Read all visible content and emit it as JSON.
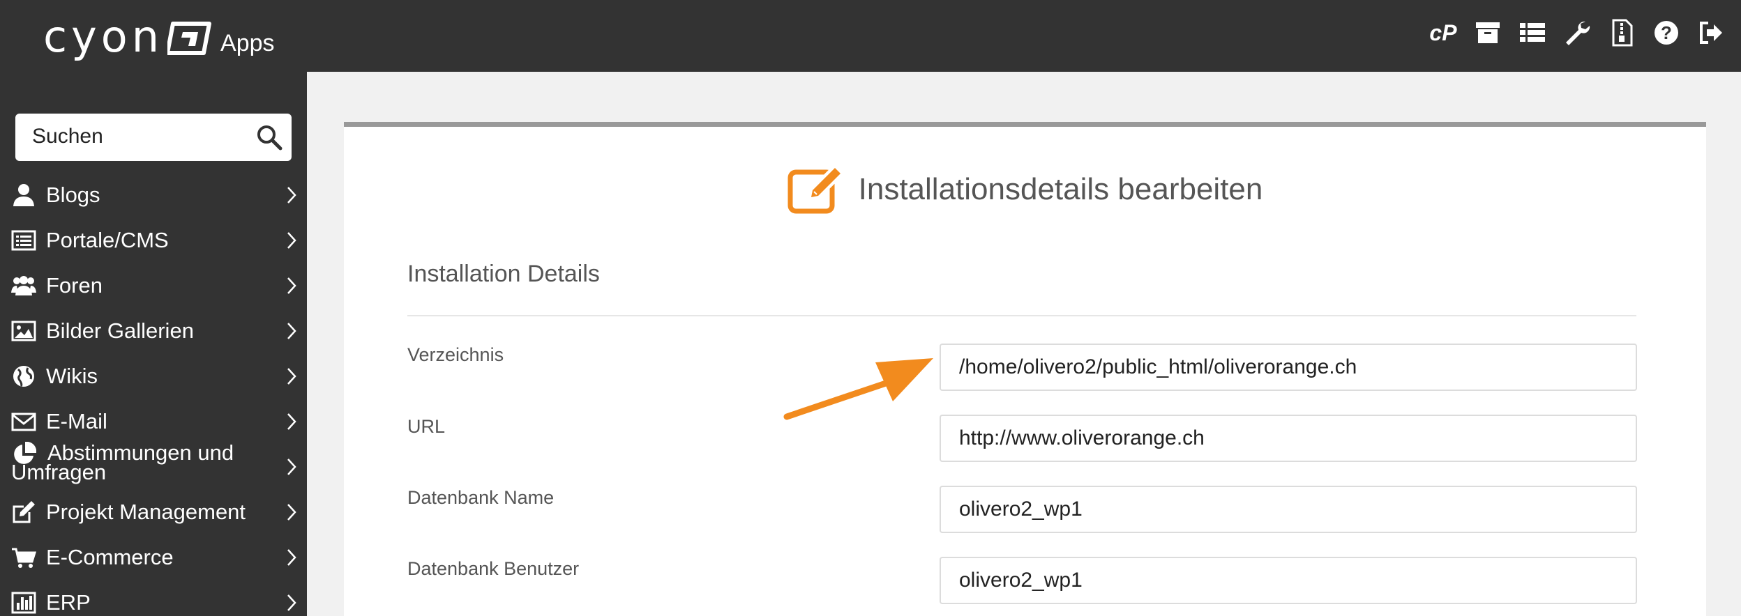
{
  "header": {
    "logo_text": "cyon",
    "apps_label": "Apps",
    "icons": [
      "cpanel-icon",
      "archive-icon",
      "list-icon",
      "wrench-icon",
      "zip-file-icon",
      "help-icon",
      "logout-icon"
    ],
    "icon_labels": {
      "cpanel": "cP"
    }
  },
  "sidebar": {
    "search_placeholder": "Suchen",
    "items": [
      {
        "label": "Blogs",
        "icon": "user-icon"
      },
      {
        "label": "Portale/CMS",
        "icon": "list-icon"
      },
      {
        "label": "Foren",
        "icon": "users-icon"
      },
      {
        "label": "Bilder Gallerien",
        "icon": "image-icon"
      },
      {
        "label": "Wikis",
        "icon": "globe-icon"
      },
      {
        "label": "E-Mail",
        "icon": "envelope-icon"
      },
      {
        "label": "Abstimmungen und Umfragen",
        "icon": "pie-chart-icon"
      },
      {
        "label": "Projekt Management",
        "icon": "edit-icon"
      },
      {
        "label": "E-Commerce",
        "icon": "cart-icon"
      },
      {
        "label": "ERP",
        "icon": "bar-chart-icon"
      }
    ]
  },
  "main": {
    "title": "Installationsdetails bearbeiten",
    "section_title": "Installation Details",
    "rows": [
      {
        "label": "Verzeichnis",
        "value": "/home/olivero2/public_html/oliverorange.ch"
      },
      {
        "label": "URL",
        "value": "http://www.oliverorange.ch"
      },
      {
        "label": "Datenbank Name",
        "value": "olivero2_wp1"
      },
      {
        "label": "Datenbank Benutzer",
        "value": "olivero2_wp1"
      }
    ]
  },
  "colors": {
    "topbar": "#333333",
    "accent": "#f28b1e",
    "panel_border": "#999999"
  }
}
